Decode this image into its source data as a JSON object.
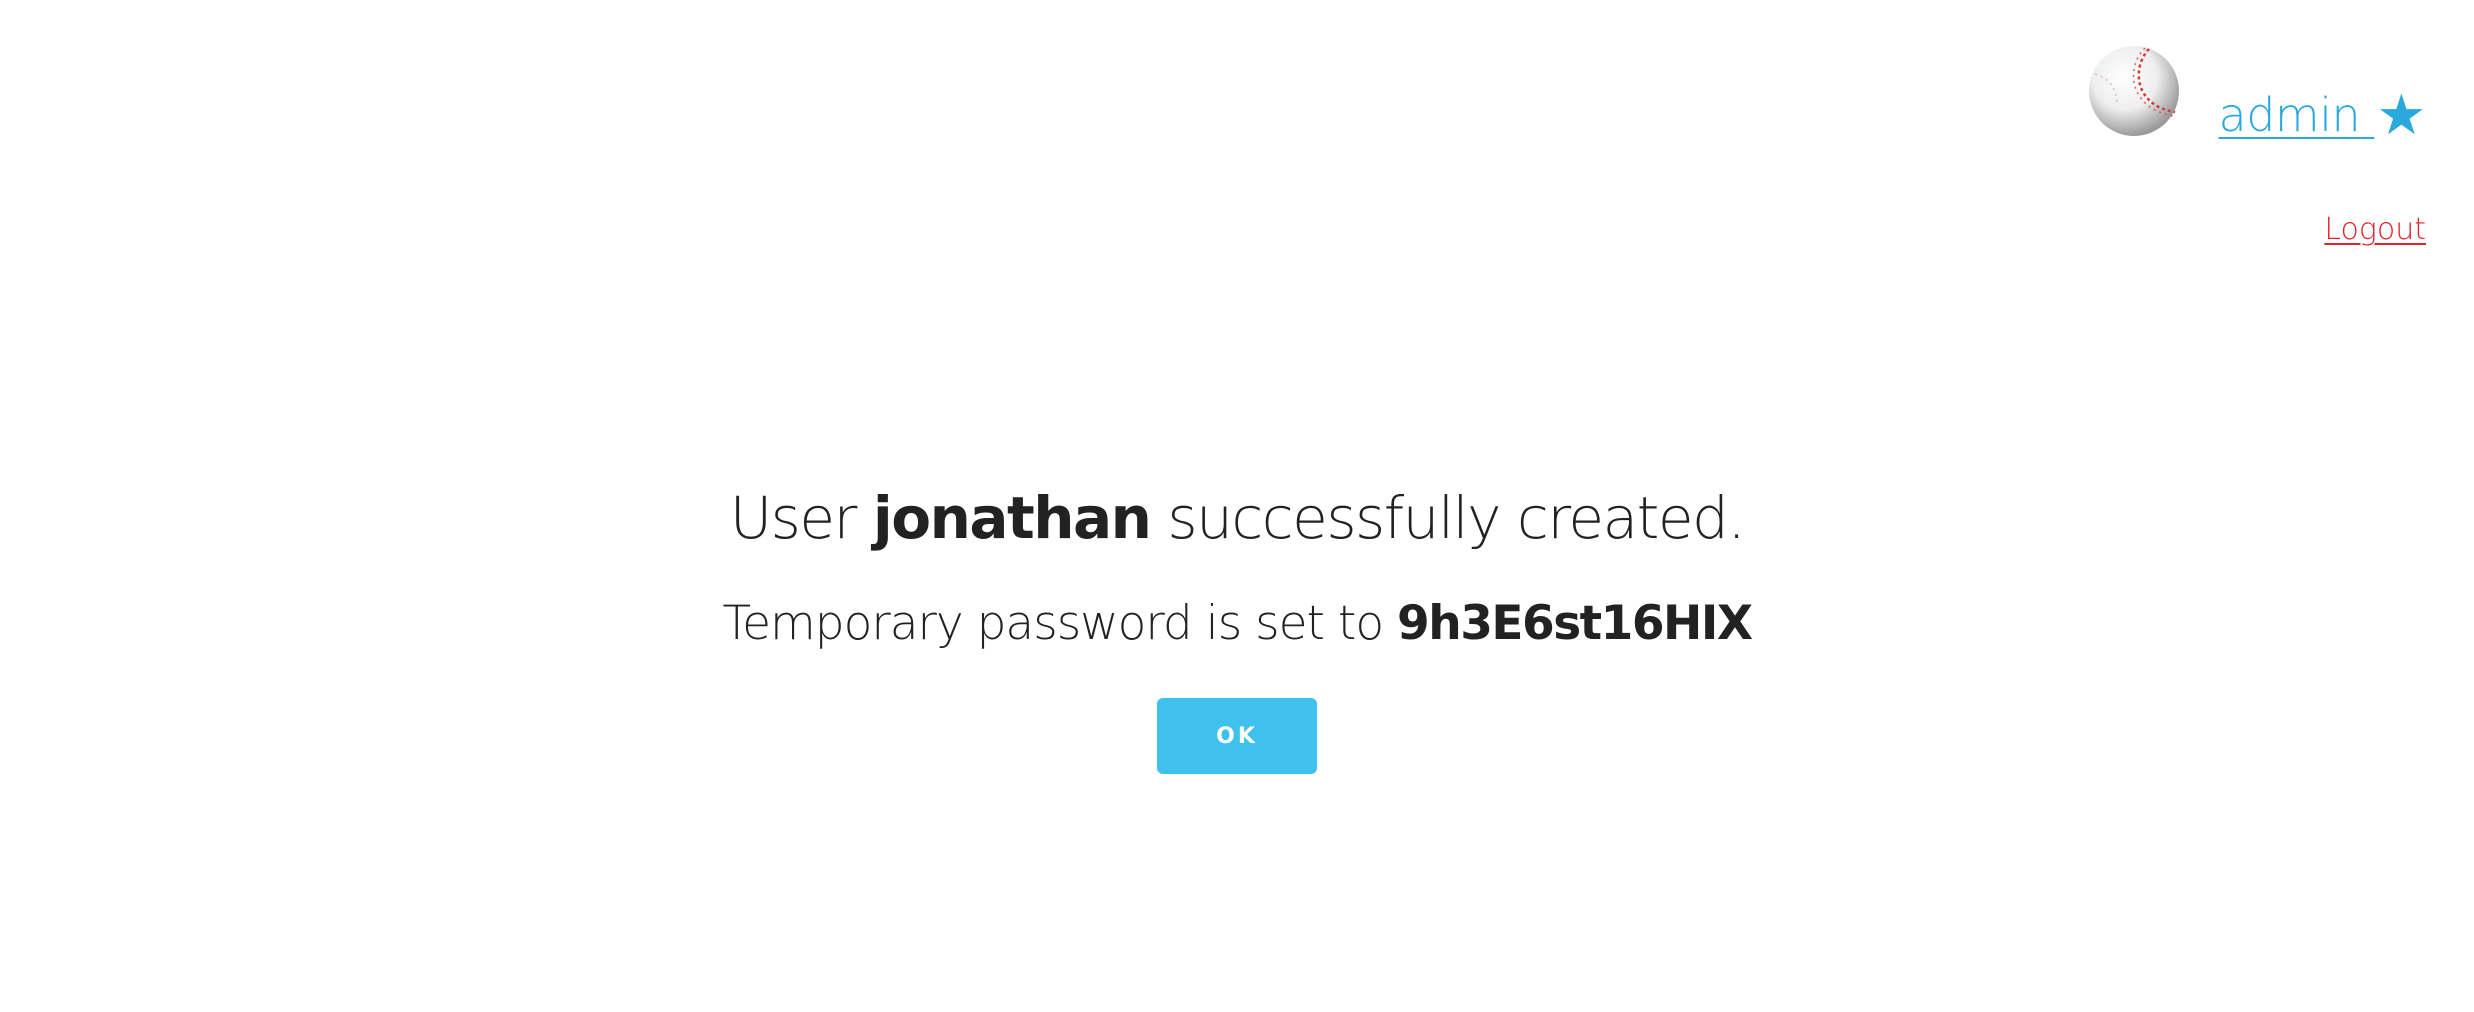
{
  "header": {
    "username": "admin",
    "role_icon": "star-icon",
    "logout_label": "Logout",
    "avatar_icon": "baseball-icon"
  },
  "message": {
    "line1_prefix": "User ",
    "line1_user": "jonathan",
    "line1_suffix": " successfully created.",
    "line2_prefix": "Temporary password is set to ",
    "line2_password": "9h3E6st16HIX"
  },
  "actions": {
    "ok_label": "OK"
  },
  "colors": {
    "link": "#2aa9dc",
    "logout": "#e8202a",
    "button": "#3fc1ee",
    "text": "#222222"
  }
}
